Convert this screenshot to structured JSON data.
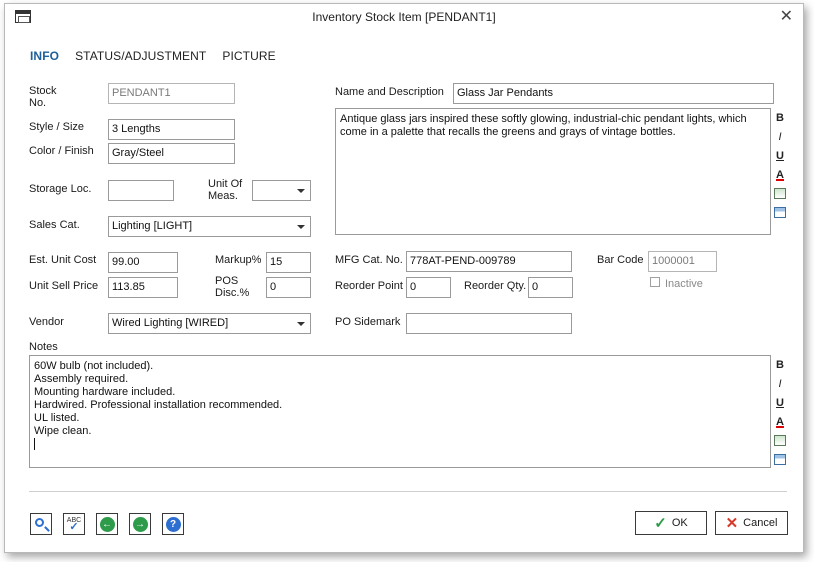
{
  "window": {
    "title": "Inventory Stock Item [PENDANT1]",
    "close": "✕"
  },
  "tabs": [
    {
      "label": "INFO",
      "active": true
    },
    {
      "label": "STATUS/ADJUSTMENT",
      "active": false
    },
    {
      "label": "PICTURE",
      "active": false
    }
  ],
  "fields": {
    "stock_no": {
      "label": "Stock\nNo.",
      "value": "PENDANT1"
    },
    "style_size": {
      "label": "Style / Size",
      "value": "3 Lengths"
    },
    "color_finish": {
      "label": "Color / Finish",
      "value": "Gray/Steel"
    },
    "storage_loc": {
      "label": "Storage Loc.",
      "value": ""
    },
    "unit_of_meas": {
      "label": "Unit Of\nMeas.",
      "value": ""
    },
    "sales_cat": {
      "label": "Sales Cat.",
      "value": "Lighting [LIGHT]"
    },
    "est_unit_cost": {
      "label": "Est. Unit Cost",
      "value": "99.00"
    },
    "markup": {
      "label": "Markup%",
      "value": "15"
    },
    "unit_sell_price": {
      "label": "Unit Sell Price",
      "value": "113.85"
    },
    "pos_disc": {
      "label": "POS\nDisc.%",
      "value": "0"
    },
    "vendor": {
      "label": "Vendor",
      "value": "Wired Lighting [WIRED]"
    },
    "name_desc": {
      "label": "Name and Description",
      "value": "Glass Jar Pendants"
    },
    "description": "Antique glass jars inspired these softly glowing, industrial-chic pendant lights, which come in a palette that recalls the greens and grays of vintage bottles.",
    "mfg_cat_no": {
      "label": "MFG Cat. No.",
      "value": "778AT-PEND-009789"
    },
    "bar_code": {
      "label": "Bar Code",
      "value": "1000001"
    },
    "inactive": {
      "label": "Inactive",
      "checked": false
    },
    "reorder_point": {
      "label": "Reorder Point",
      "value": "0"
    },
    "reorder_qty": {
      "label": "Reorder Qty.",
      "value": "0"
    },
    "po_sidemark": {
      "label": "PO Sidemark",
      "value": ""
    }
  },
  "notes": {
    "label": "Notes",
    "lines": [
      "60W bulb (not included).",
      "Assembly required.",
      "Mounting hardware included.",
      "Hardwired. Professional installation recommended.",
      "UL listed.",
      "Wipe clean."
    ]
  },
  "richtext_toolbar": {
    "bold": "B",
    "italic": "I",
    "underline": "U",
    "color": "A"
  },
  "buttons": {
    "ok": "OK",
    "cancel": "Cancel",
    "spell_top": "ABC"
  },
  "colors": {
    "accent": "#1f5f9a",
    "ok_green": "#2e9b4a",
    "cancel_red": "#d63a2a",
    "nav_blue": "#2d6fd0"
  }
}
